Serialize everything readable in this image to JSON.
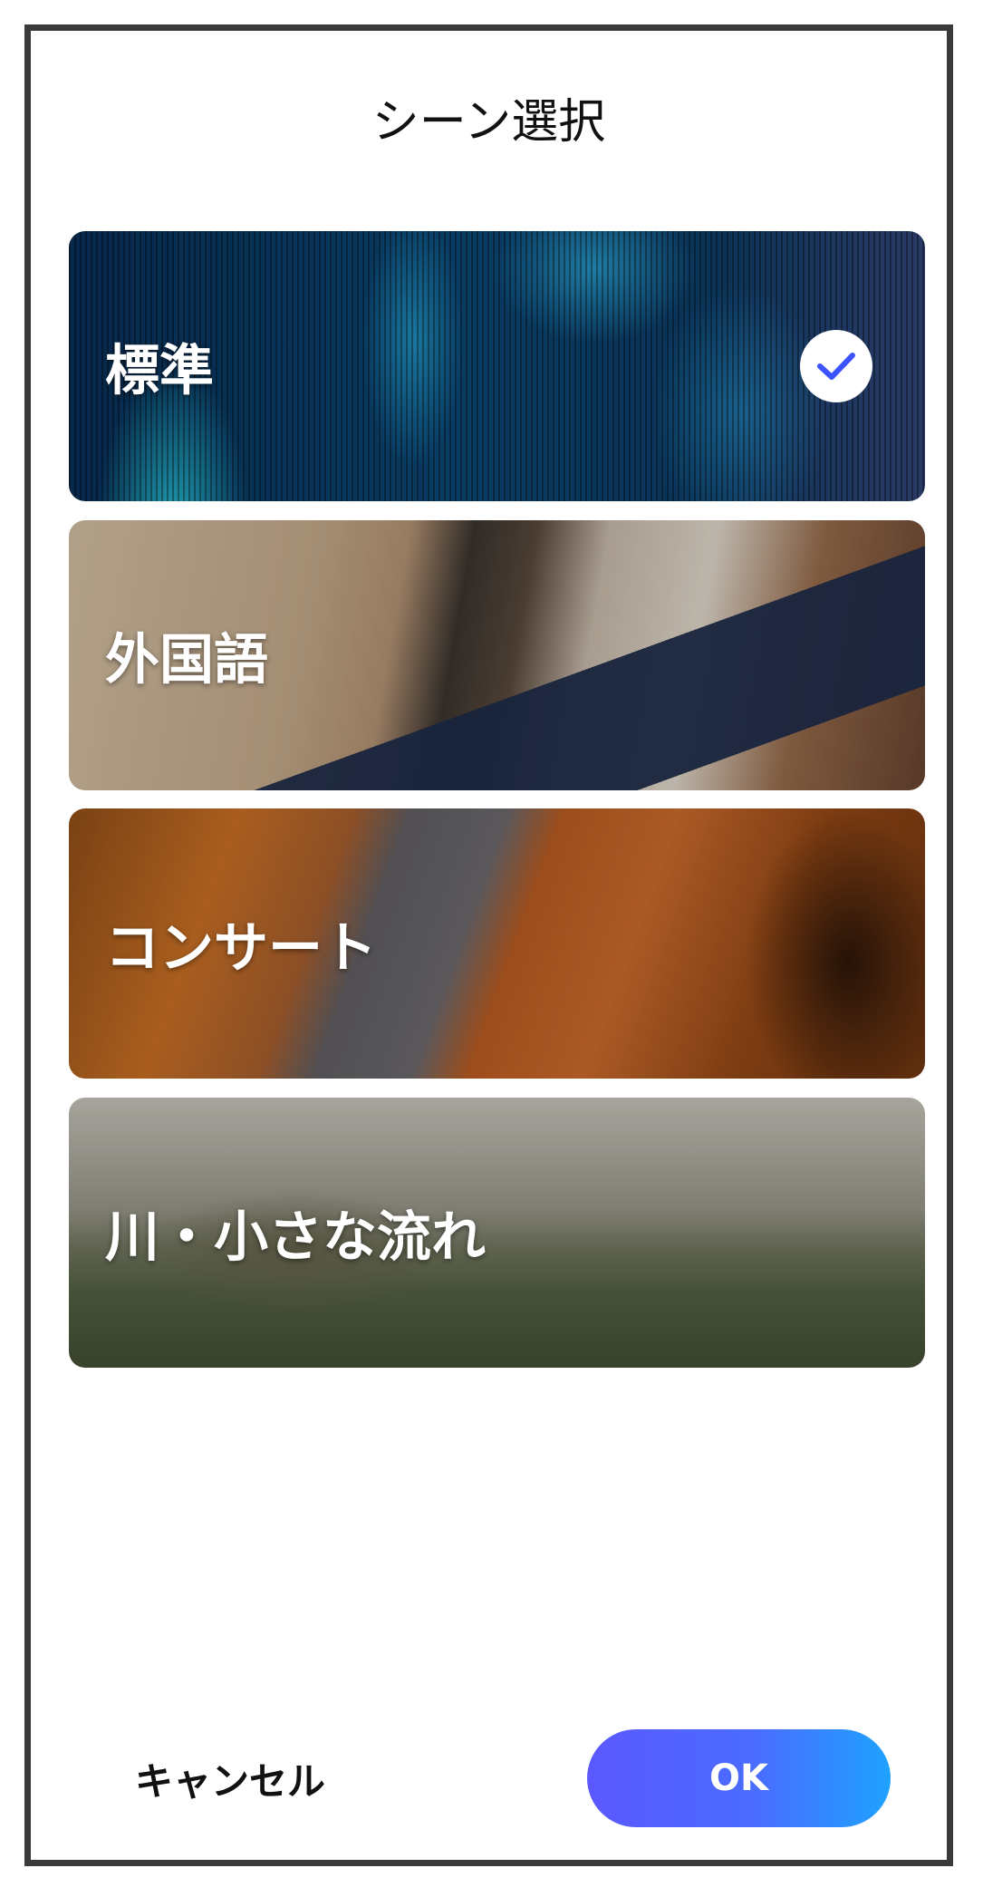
{
  "dialog": {
    "title": "シーン選択"
  },
  "scenes": [
    {
      "label": "標準",
      "selected": true,
      "image": "sound-wave"
    },
    {
      "label": "外国語",
      "selected": false,
      "image": "reading-books"
    },
    {
      "label": "コンサート",
      "selected": false,
      "image": "cello"
    },
    {
      "label": "川・小さな流れ",
      "selected": false,
      "image": "river-stream"
    }
  ],
  "footer": {
    "cancel_label": "キャンセル",
    "ok_label": "OK"
  },
  "colors": {
    "accent_start": "#5b58ff",
    "accent_end": "#1ea2ff",
    "check": "#3b52ff"
  }
}
